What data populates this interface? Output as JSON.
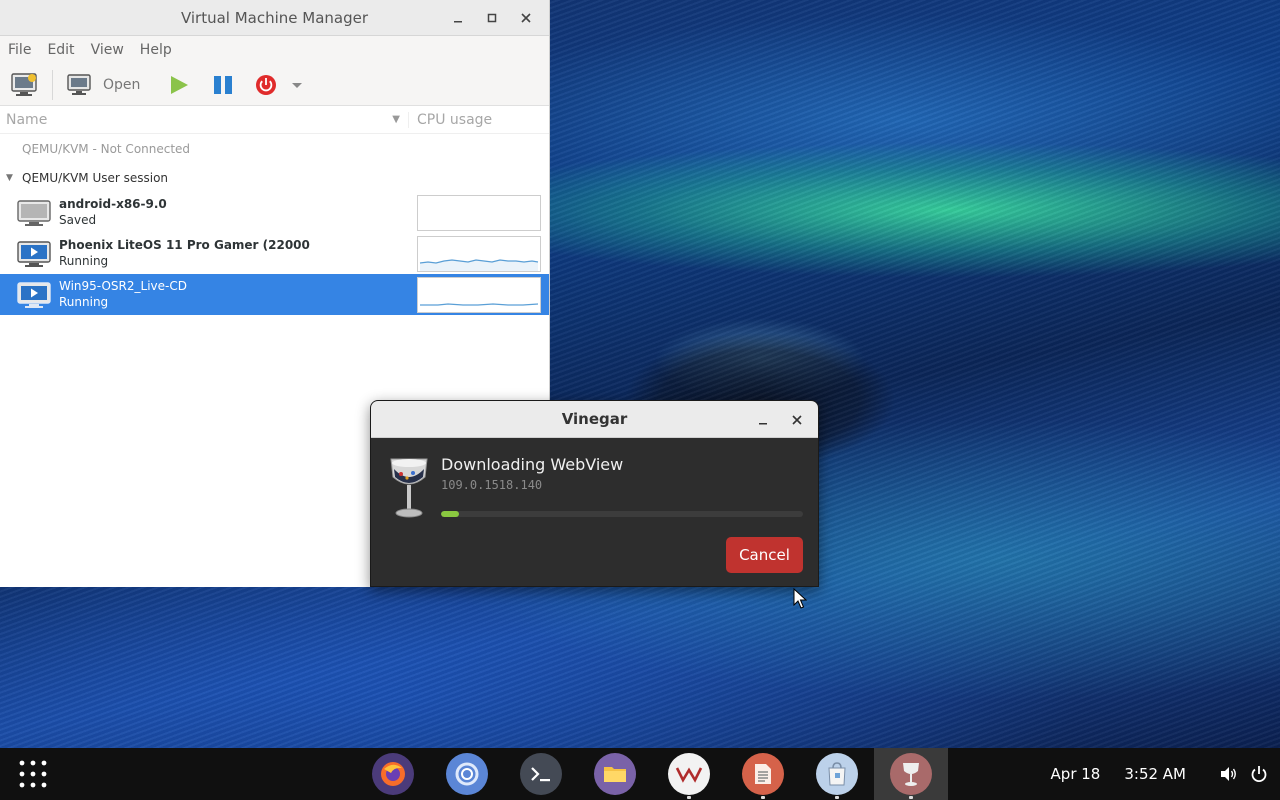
{
  "vmm": {
    "title": "Virtual Machine Manager",
    "menu": [
      "File",
      "Edit",
      "View",
      "Help"
    ],
    "toolbar": {
      "open_label": "Open"
    },
    "columns": {
      "name": "Name",
      "cpu": "CPU usage"
    },
    "connections": {
      "disconnected": "QEMU/KVM - Not Connected",
      "session": "QEMU/KVM User session"
    },
    "vms": [
      {
        "name": "android-x86-9.0",
        "status": "Saved",
        "selected": false
      },
      {
        "name": "Phoenix LiteOS 11 Pro Gamer (22000",
        "status": "Running",
        "selected": false
      },
      {
        "name": "Win95-OSR2_Live-CD",
        "status": "Running",
        "selected": true
      }
    ]
  },
  "vinegar": {
    "title": "Vinegar",
    "heading": "Downloading WebView",
    "version": "109.0.1518.140",
    "progress": 0.05,
    "cancel_label": "Cancel"
  },
  "taskbar": {
    "date": "Apr 18",
    "time": "3:52 AM",
    "dock": [
      {
        "name": "firefox-icon",
        "color": "#6a4fa3",
        "active": false,
        "dot": false
      },
      {
        "name": "chromium-icon",
        "color": "#5b86d6",
        "active": false,
        "dot": false
      },
      {
        "name": "terminal-icon",
        "color": "#444a55",
        "active": false,
        "dot": false
      },
      {
        "name": "files-icon",
        "color": "#7a62a8",
        "active": false,
        "dot": false
      },
      {
        "name": "virt-manager-icon",
        "color": "#f2f2f2",
        "active": false,
        "dot": true
      },
      {
        "name": "text-editor-icon",
        "color": "#d5624a",
        "active": false,
        "dot": true
      },
      {
        "name": "software-store-icon",
        "color": "#bcd1ea",
        "active": false,
        "dot": true
      },
      {
        "name": "vinegar-icon",
        "color": "#a96a6a",
        "active": true,
        "dot": true
      }
    ]
  },
  "colors": {
    "selection": "#3584e4",
    "cancel": "#c0332f",
    "progress": "#8ac840",
    "play": "#8bc34a",
    "pause": "#2a80d0",
    "power": "#e02b2b"
  }
}
